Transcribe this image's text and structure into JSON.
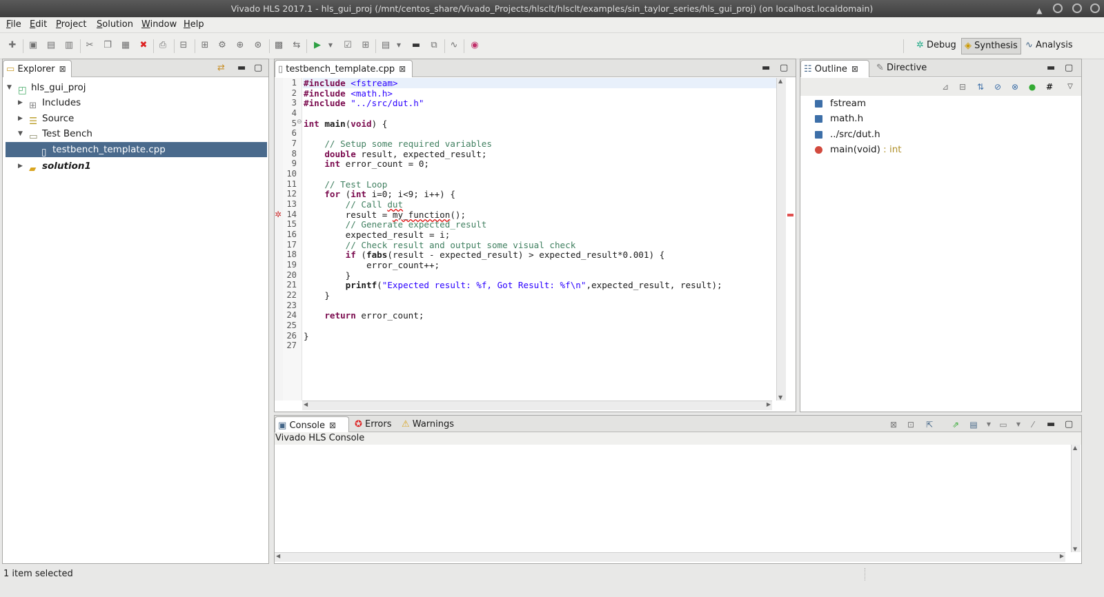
{
  "window": {
    "title": "Vivado HLS 2017.1 - hls_gui_proj (/mnt/centos_share/Vivado_Projects/hlsclt/hlsclt/examples/sin_taylor_series/hls_gui_proj)   (on localhost.localdomain)"
  },
  "menu": [
    {
      "u": "F",
      "rest": "ile"
    },
    {
      "u": "E",
      "rest": "dit"
    },
    {
      "u": "P",
      "rest": "roject"
    },
    {
      "u": "S",
      "rest": "olution"
    },
    {
      "u": "W",
      "rest": "indow"
    },
    {
      "u": "H",
      "rest": "elp"
    }
  ],
  "perspectives": {
    "debug": "Debug",
    "synthesis": "Synthesis",
    "analysis": "Analysis"
  },
  "explorer": {
    "tab": "Explorer",
    "project": "hls_gui_proj",
    "includes": "Includes",
    "source": "Source",
    "testbench": "Test Bench",
    "file": "testbench_template.cpp",
    "solution": "solution1"
  },
  "editor": {
    "tab": "testbench_template.cpp",
    "lines": [
      "1",
      "2",
      "3",
      "4",
      "5",
      "6",
      "7",
      "8",
      "9",
      "10",
      "11",
      "12",
      "13",
      "14",
      "15",
      "16",
      "17",
      "18",
      "19",
      "20",
      "21",
      "22",
      "23",
      "24",
      "25",
      "26",
      "27"
    ]
  },
  "outline": {
    "tab": "Outline",
    "tab2": "Directive",
    "items": [
      "fstream",
      "math.h",
      "../src/dut.h",
      "main(void)"
    ],
    "main_type": " : int"
  },
  "console": {
    "tab": "Console",
    "errors": "Errors",
    "warnings": "Warnings",
    "title": "Vivado HLS Console"
  },
  "status": {
    "text": "1 item selected"
  },
  "colors": {
    "selection": "#4a6a8c",
    "keyword": "#7a0a4e",
    "string": "#2a00ff",
    "comment": "#3f7f5f"
  }
}
